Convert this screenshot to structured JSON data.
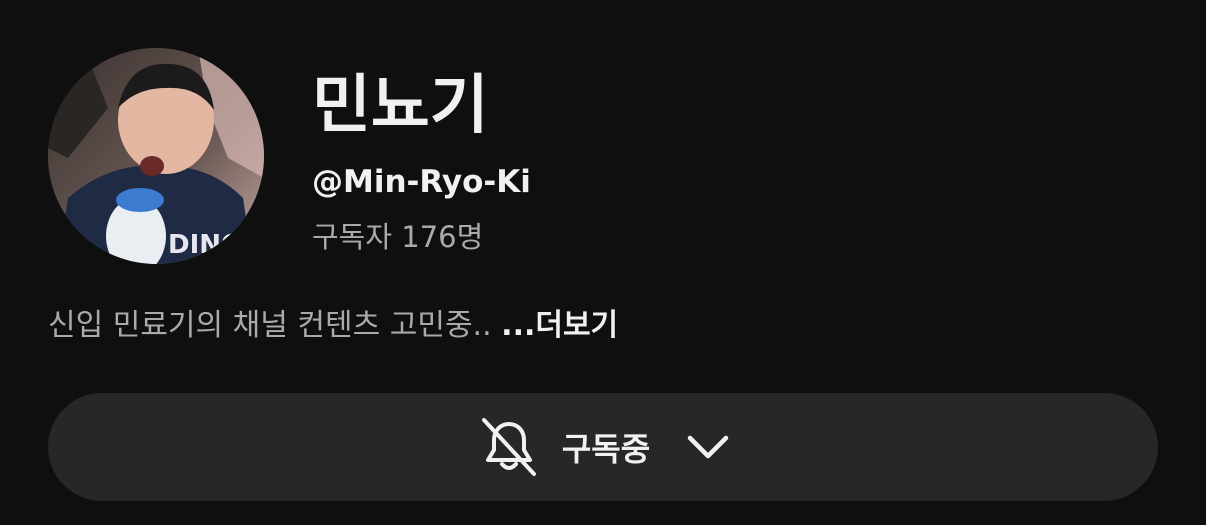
{
  "channel": {
    "name": "민뇨기",
    "handle": "@Min-Ryo-Ki",
    "subscribers": "구독자 176명",
    "description": "신입 민료기의 채널 컨텐츠 고민중..",
    "more_label": "...더보기"
  },
  "subscribe": {
    "label": "구독중",
    "bell_icon": "bell-off-icon",
    "dropdown_icon": "chevron-down-icon"
  },
  "colors": {
    "background": "#0f0f0f",
    "button_bg": "#272727",
    "text_primary": "#f1f1f1",
    "text_secondary": "#aaaaaa"
  }
}
